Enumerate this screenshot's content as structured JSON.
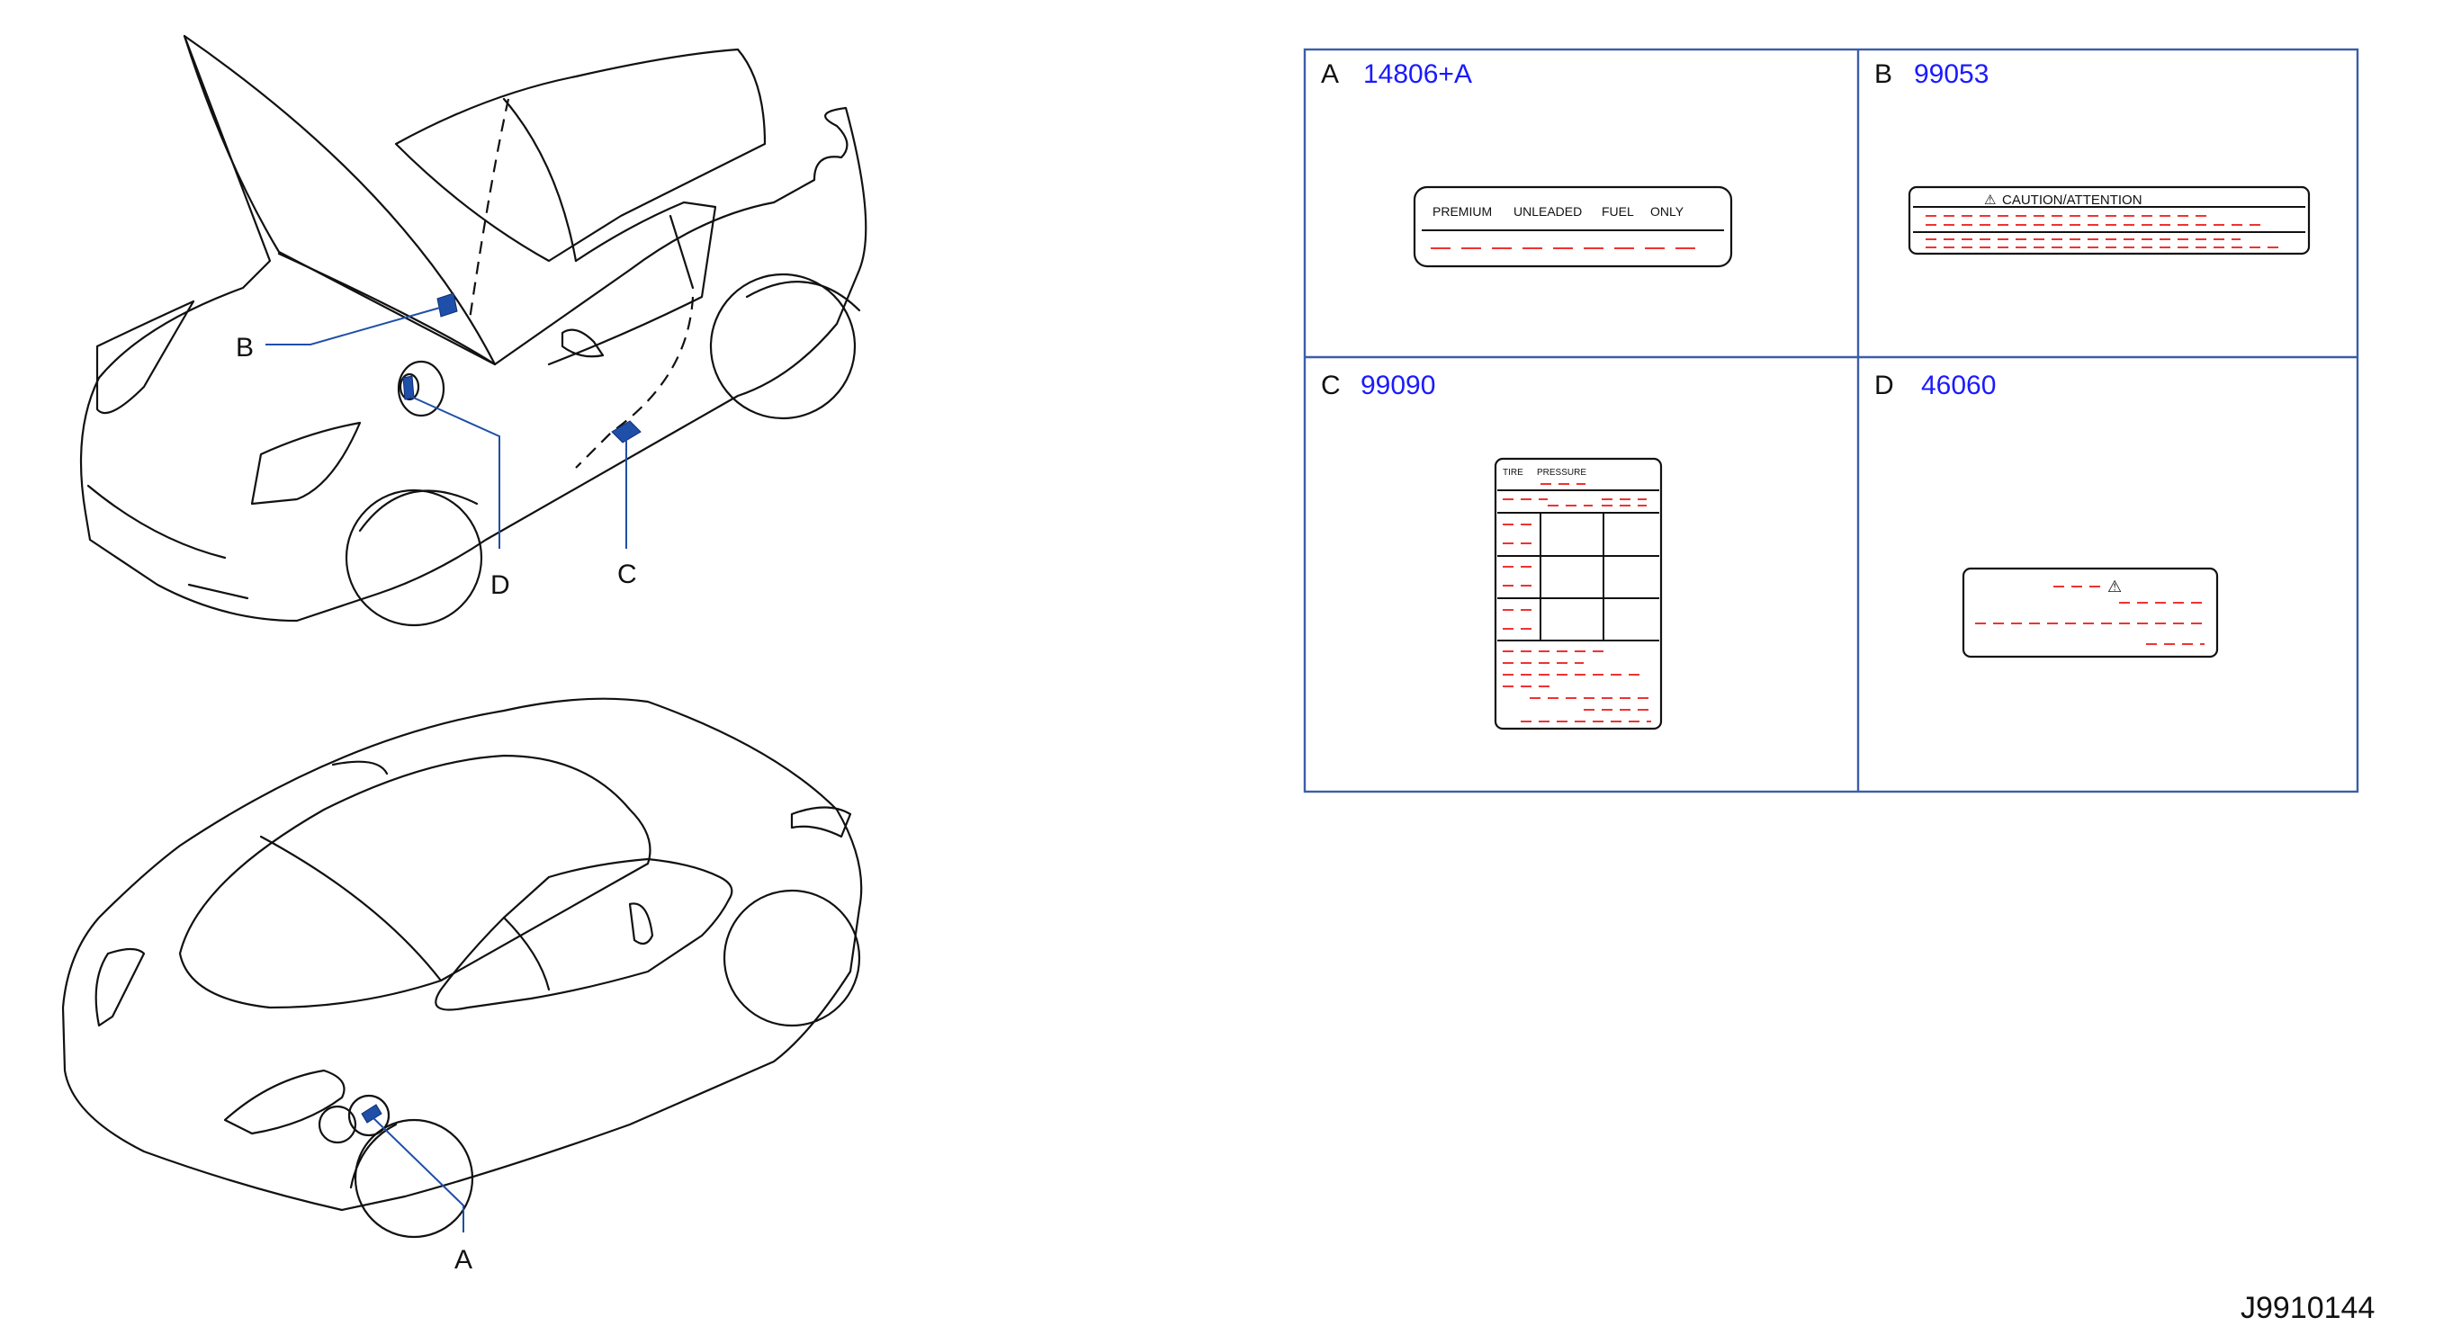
{
  "callouts": {
    "a": "A",
    "b": "B",
    "c": "C",
    "d": "D"
  },
  "panels": [
    {
      "letter": "A",
      "part_number": "14806+A"
    },
    {
      "letter": "B",
      "part_number": "99053"
    },
    {
      "letter": "C",
      "part_number": "99090"
    },
    {
      "letter": "D",
      "part_number": "46060"
    }
  ],
  "labels": {
    "fuel": {
      "words": [
        "PREMIUM",
        "UNLEADED",
        "FUEL",
        "ONLY"
      ]
    },
    "caution": {
      "title": "CAUTION/ATTENTION"
    },
    "tire": {
      "words": [
        "TIRE",
        "PRESSURE"
      ]
    },
    "warning": {
      "symbol": "⚠"
    }
  },
  "reference_code": "J9910144",
  "colors": {
    "accent_blue": "#1f4fa8",
    "part_blue": "#1a1aff",
    "redline": "#ee3333",
    "frame": "#3b5ea8"
  }
}
